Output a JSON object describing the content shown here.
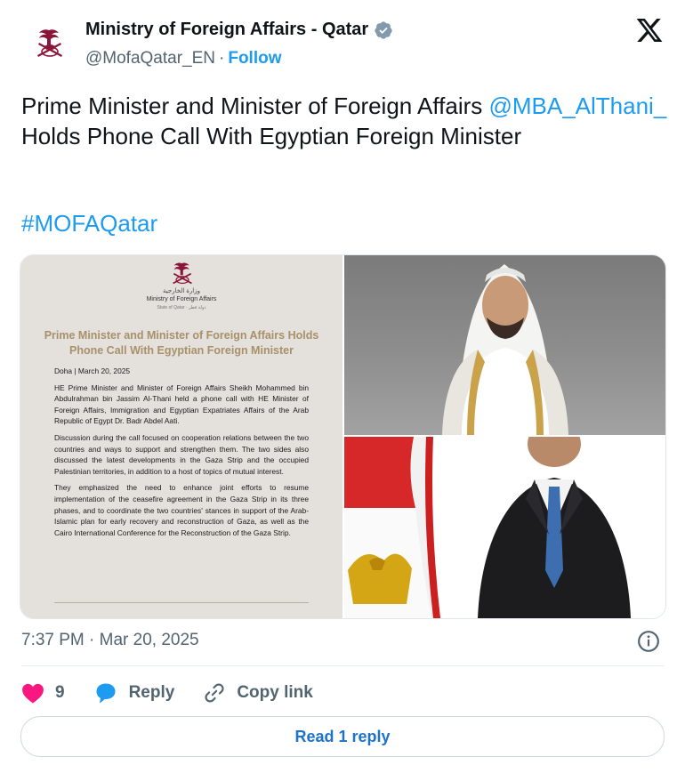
{
  "account": {
    "name": "Ministry of Foreign Affairs - Qatar",
    "handle": "@MofaQatar_EN",
    "separator": "·",
    "follow_label": "Follow"
  },
  "tweet": {
    "text_part1": "Prime Minister and Minister of Foreign Affairs ",
    "mention": "@MBA_AlThani_",
    "text_part2": "  Holds Phone Call With Egyptian Foreign Minister",
    "hashtag": "#MOFAQatar"
  },
  "document": {
    "ministry_ar": "وزارة الخارجية",
    "ministry_en": "Ministry of Foreign Affairs",
    "state": "State of Qatar · دولة قطر",
    "title": "Prime Minister and Minister of Foreign Affairs Holds Phone Call With Egyptian Foreign Minister",
    "dateline": "Doha | March 20, 2025",
    "paragraph1": "HE Prime Minister and Minister of Foreign Affairs Sheikh Mohammed bin Abdulrahman bin Jassim Al-Thani held a phone call with HE Minister of Foreign Affairs, Immigration and Egyptian Expatriates Affairs of the Arab Republic of Egypt Dr. Badr Abdel Aati.",
    "paragraph2": "Discussion during the call focused on cooperation relations between the two countries and ways to support and strengthen them. The two sides also discussed the latest developments in the Gaza Strip and the occupied Palestinian territories, in addition to a host of topics of mutual interest.",
    "paragraph3": "They emphasized the need to enhance joint efforts to resume implementation of the ceasefire agreement in the Gaza Strip in its three phases, and to coordinate the two countries' stances in support of the Arab-Islamic plan for early recovery and reconstruction of Gaza, as well as the Cairo International Conference for the Reconstruction of the Gaza Strip."
  },
  "meta": {
    "timestamp": "7:37 PM · Mar 20, 2025"
  },
  "actions": {
    "likes": "9",
    "reply_label": "Reply",
    "copy_link_label": "Copy link",
    "read_replies_label": "Read 1 reply"
  },
  "colors": {
    "link": "#1d9bf0",
    "like": "#f91880",
    "reply_icon": "#1d9bf0",
    "doc_title": "#a8906a",
    "read_button_text": "#1d73c9"
  },
  "icons": [
    "mofa-emblem-icon",
    "verified-badge-icon",
    "x-logo-icon",
    "info-icon",
    "heart-icon",
    "reply-bubble-icon",
    "link-icon"
  ]
}
